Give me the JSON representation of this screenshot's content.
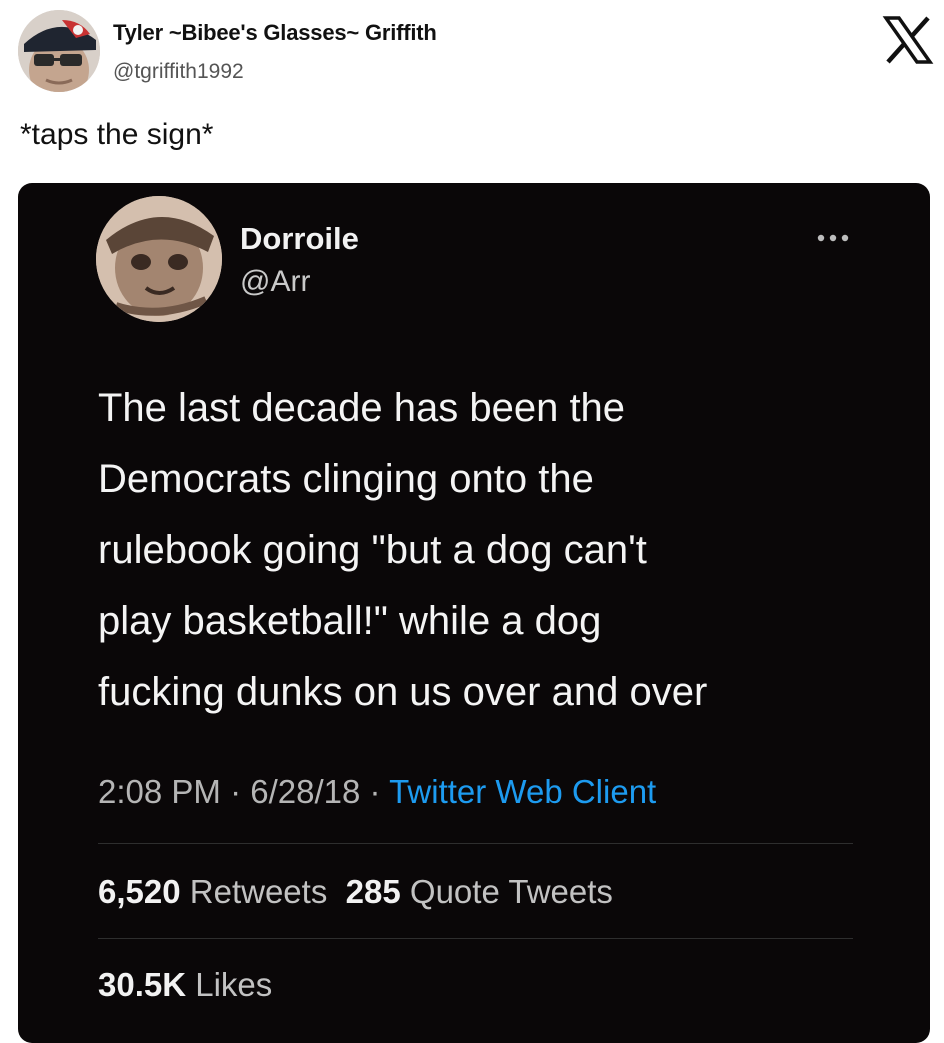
{
  "outer_tweet": {
    "author_name": "Tyler ~Bibee's Glasses~ Griffith",
    "author_handle": "@tgriffith1992",
    "text": "*taps the sign*",
    "platform_icon": "x-logo-icon",
    "avatar_icon": "profile-avatar"
  },
  "quoted_tweet": {
    "author_name": "Dorroile",
    "author_handle": "@Arr",
    "more_icon": "more-options-icon",
    "text_lines": [
      "The last decade has been the",
      "Democrats clinging onto the",
      "rulebook going \"but a dog can't",
      "play basketball!\" while a dog",
      "fucking dunks on us over and over"
    ],
    "time": "2:08 PM",
    "date": "6/28/18",
    "separator": " · ",
    "client": "Twitter Web Client",
    "retweets_count": "6,520",
    "retweets_label": "Retweets",
    "quotes_count": "285",
    "quotes_label": "Quote Tweets",
    "likes_count": "30.5K",
    "likes_label": "Likes"
  },
  "colors": {
    "card_background": "#0a0708",
    "link_blue": "#1d9bf0",
    "page_background": "#ffffff"
  }
}
